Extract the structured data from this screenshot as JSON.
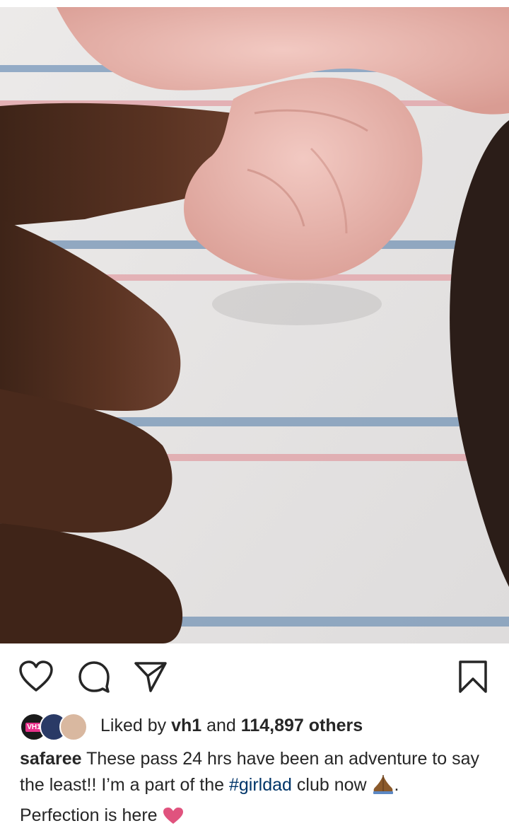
{
  "post": {
    "image_alt": "",
    "actions": {
      "like_icon": "heart-icon",
      "comment_icon": "comment-icon",
      "share_icon": "send-icon",
      "save_icon": "bookmark-icon"
    },
    "likes": {
      "prefix": "Liked by",
      "user": "vh1",
      "conjunction": "and",
      "count_text": "114,897 others",
      "avatar_badge": "VH1"
    },
    "caption": {
      "username": "safaree",
      "text_1": "These pass 24 hrs have been an adventure to say the least!! I’m a part of the",
      "hashtag": "#girldad",
      "text_2": "club now",
      "text_3": ".",
      "text_4": "Perfection is here"
    }
  },
  "colors": {
    "text": "#262626",
    "hashtag": "#003569",
    "heart_emoji": "#e0537e"
  }
}
